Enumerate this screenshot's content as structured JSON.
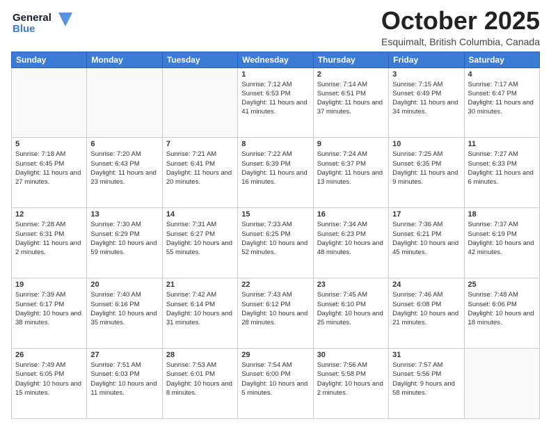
{
  "header": {
    "logo_line1": "General",
    "logo_line2": "Blue",
    "month": "October 2025",
    "location": "Esquimalt, British Columbia, Canada"
  },
  "days_of_week": [
    "Sunday",
    "Monday",
    "Tuesday",
    "Wednesday",
    "Thursday",
    "Friday",
    "Saturday"
  ],
  "weeks": [
    [
      {
        "day": "",
        "content": ""
      },
      {
        "day": "",
        "content": ""
      },
      {
        "day": "",
        "content": ""
      },
      {
        "day": "1",
        "content": "Sunrise: 7:12 AM\nSunset: 6:53 PM\nDaylight: 11 hours and 41 minutes."
      },
      {
        "day": "2",
        "content": "Sunrise: 7:14 AM\nSunset: 6:51 PM\nDaylight: 11 hours and 37 minutes."
      },
      {
        "day": "3",
        "content": "Sunrise: 7:15 AM\nSunset: 6:49 PM\nDaylight: 11 hours and 34 minutes."
      },
      {
        "day": "4",
        "content": "Sunrise: 7:17 AM\nSunset: 6:47 PM\nDaylight: 11 hours and 30 minutes."
      }
    ],
    [
      {
        "day": "5",
        "content": "Sunrise: 7:18 AM\nSunset: 6:45 PM\nDaylight: 11 hours and 27 minutes."
      },
      {
        "day": "6",
        "content": "Sunrise: 7:20 AM\nSunset: 6:43 PM\nDaylight: 11 hours and 23 minutes."
      },
      {
        "day": "7",
        "content": "Sunrise: 7:21 AM\nSunset: 6:41 PM\nDaylight: 11 hours and 20 minutes."
      },
      {
        "day": "8",
        "content": "Sunrise: 7:22 AM\nSunset: 6:39 PM\nDaylight: 11 hours and 16 minutes."
      },
      {
        "day": "9",
        "content": "Sunrise: 7:24 AM\nSunset: 6:37 PM\nDaylight: 11 hours and 13 minutes."
      },
      {
        "day": "10",
        "content": "Sunrise: 7:25 AM\nSunset: 6:35 PM\nDaylight: 11 hours and 9 minutes."
      },
      {
        "day": "11",
        "content": "Sunrise: 7:27 AM\nSunset: 6:33 PM\nDaylight: 11 hours and 6 minutes."
      }
    ],
    [
      {
        "day": "12",
        "content": "Sunrise: 7:28 AM\nSunset: 6:31 PM\nDaylight: 11 hours and 2 minutes."
      },
      {
        "day": "13",
        "content": "Sunrise: 7:30 AM\nSunset: 6:29 PM\nDaylight: 10 hours and 59 minutes."
      },
      {
        "day": "14",
        "content": "Sunrise: 7:31 AM\nSunset: 6:27 PM\nDaylight: 10 hours and 55 minutes."
      },
      {
        "day": "15",
        "content": "Sunrise: 7:33 AM\nSunset: 6:25 PM\nDaylight: 10 hours and 52 minutes."
      },
      {
        "day": "16",
        "content": "Sunrise: 7:34 AM\nSunset: 6:23 PM\nDaylight: 10 hours and 48 minutes."
      },
      {
        "day": "17",
        "content": "Sunrise: 7:36 AM\nSunset: 6:21 PM\nDaylight: 10 hours and 45 minutes."
      },
      {
        "day": "18",
        "content": "Sunrise: 7:37 AM\nSunset: 6:19 PM\nDaylight: 10 hours and 42 minutes."
      }
    ],
    [
      {
        "day": "19",
        "content": "Sunrise: 7:39 AM\nSunset: 6:17 PM\nDaylight: 10 hours and 38 minutes."
      },
      {
        "day": "20",
        "content": "Sunrise: 7:40 AM\nSunset: 6:16 PM\nDaylight: 10 hours and 35 minutes."
      },
      {
        "day": "21",
        "content": "Sunrise: 7:42 AM\nSunset: 6:14 PM\nDaylight: 10 hours and 31 minutes."
      },
      {
        "day": "22",
        "content": "Sunrise: 7:43 AM\nSunset: 6:12 PM\nDaylight: 10 hours and 28 minutes."
      },
      {
        "day": "23",
        "content": "Sunrise: 7:45 AM\nSunset: 6:10 PM\nDaylight: 10 hours and 25 minutes."
      },
      {
        "day": "24",
        "content": "Sunrise: 7:46 AM\nSunset: 6:08 PM\nDaylight: 10 hours and 21 minutes."
      },
      {
        "day": "25",
        "content": "Sunrise: 7:48 AM\nSunset: 6:06 PM\nDaylight: 10 hours and 18 minutes."
      }
    ],
    [
      {
        "day": "26",
        "content": "Sunrise: 7:49 AM\nSunset: 6:05 PM\nDaylight: 10 hours and 15 minutes."
      },
      {
        "day": "27",
        "content": "Sunrise: 7:51 AM\nSunset: 6:03 PM\nDaylight: 10 hours and 11 minutes."
      },
      {
        "day": "28",
        "content": "Sunrise: 7:53 AM\nSunset: 6:01 PM\nDaylight: 10 hours and 8 minutes."
      },
      {
        "day": "29",
        "content": "Sunrise: 7:54 AM\nSunset: 6:00 PM\nDaylight: 10 hours and 5 minutes."
      },
      {
        "day": "30",
        "content": "Sunrise: 7:56 AM\nSunset: 5:58 PM\nDaylight: 10 hours and 2 minutes."
      },
      {
        "day": "31",
        "content": "Sunrise: 7:57 AM\nSunset: 5:56 PM\nDaylight: 9 hours and 58 minutes."
      },
      {
        "day": "",
        "content": ""
      }
    ]
  ]
}
